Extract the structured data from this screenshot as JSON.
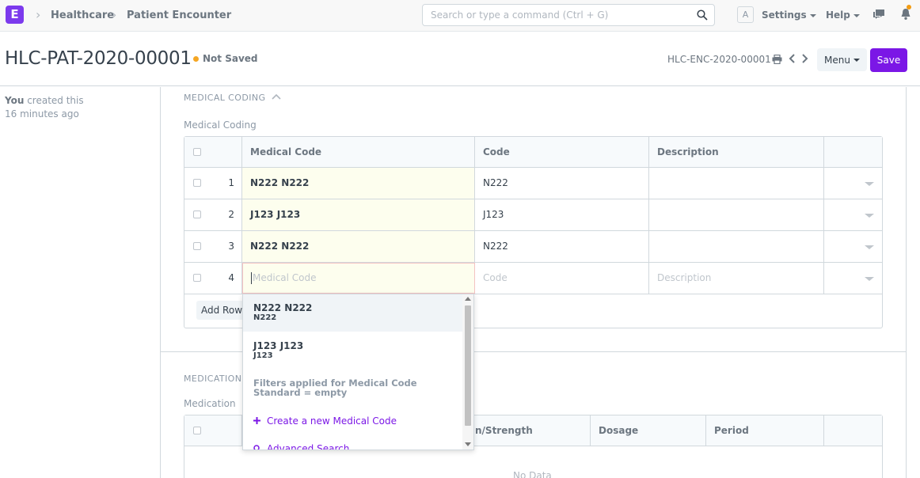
{
  "navbar": {
    "logo_letter": "E",
    "breadcrumbs": [
      "Healthcare",
      "Patient Encounter"
    ],
    "search_placeholder": "Search or type a command (Ctrl + G)",
    "avatar_letter": "A",
    "settings_label": "Settings",
    "help_label": "Help",
    "notification_dot_color": "#f39c12"
  },
  "page_head": {
    "title": "HLC-PAT-2020-00001",
    "status": "Not Saved",
    "status_color": "#f5a623",
    "doc_name": "HLC-ENC-2020-00001",
    "menu_label": "Menu",
    "save_label": "Save",
    "accent_color": "#7b17e6"
  },
  "sidebar": {
    "actor": "You",
    "action": " created this",
    "time": "16 minutes ago"
  },
  "medical_coding": {
    "section_title": "MEDICAL CODING",
    "field_label": "Medical Coding",
    "columns": [
      "Medical Code",
      "Code",
      "Description"
    ],
    "rows": [
      {
        "idx": "1",
        "medical_code": "N222 N222",
        "code": "N222",
        "description": ""
      },
      {
        "idx": "2",
        "medical_code": "J123 J123",
        "code": "J123",
        "description": ""
      },
      {
        "idx": "3",
        "medical_code": "N222 N222",
        "code": "N222",
        "description": ""
      }
    ],
    "new_row": {
      "idx": "4",
      "medical_code_placeholder": "Medical Code",
      "code_placeholder": "Code",
      "description_placeholder": "Description"
    },
    "add_row_label": "Add Row"
  },
  "autocomplete": {
    "items": [
      {
        "title": "N222 N222",
        "subtitle": "N222"
      },
      {
        "title": "J123 J123",
        "subtitle": "J123"
      }
    ],
    "filter_note": "Filters applied for Medical Code Standard = empty",
    "create_label": "Create a new Medical Code",
    "advanced_label": "Advanced Search"
  },
  "medication": {
    "section_title": "MEDICATION",
    "field_label": "Medication",
    "columns_visible": [
      "n/Strength",
      "Dosage",
      "Period"
    ],
    "empty_text": "No Data"
  }
}
